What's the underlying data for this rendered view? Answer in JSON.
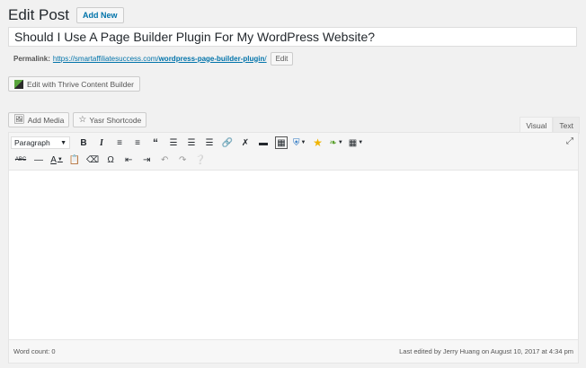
{
  "header": {
    "title": "Edit Post",
    "add_new_label": "Add New"
  },
  "post": {
    "title": "Should I Use A Page Builder Plugin For My WordPress Website?"
  },
  "permalink": {
    "label": "Permalink:",
    "url_prefix": "https://smartaffiliatesuccess.com/",
    "slug": "wordpress-page-builder-plugin",
    "url_suffix": "/",
    "edit_label": "Edit"
  },
  "thrive": {
    "label": "Edit with Thrive Content Builder"
  },
  "media": {
    "add_media_label": "Add Media",
    "yasr_label": "Yasr Shortcode"
  },
  "tabs": {
    "visual": "Visual",
    "text": "Text"
  },
  "toolbar": {
    "format_select": "Paragraph"
  },
  "status": {
    "word_count": "Word count: 0",
    "last_edited": "Last edited by Jerry Huang on August 10, 2017 at 4:34 pm"
  }
}
